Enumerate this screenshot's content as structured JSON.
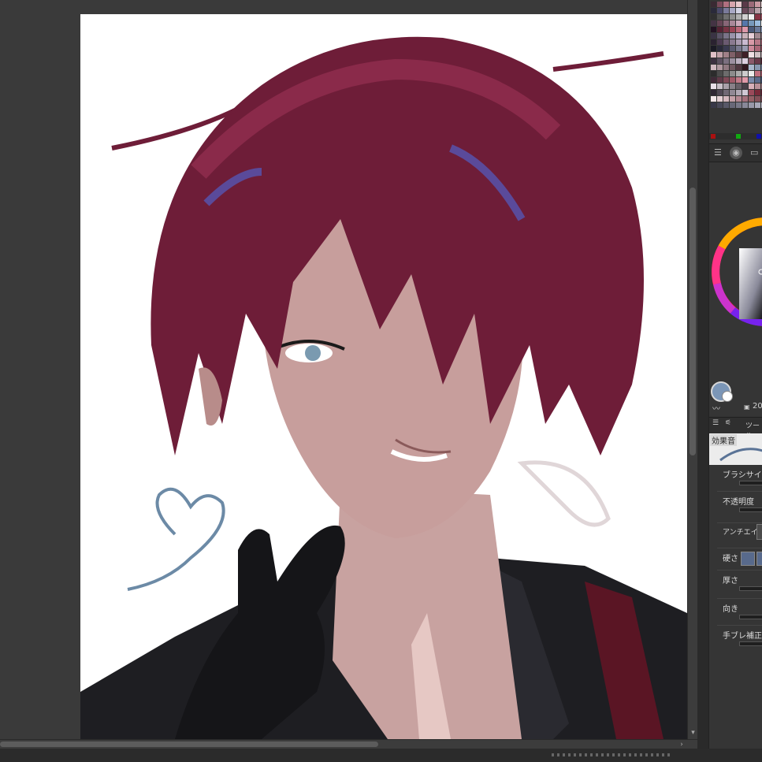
{
  "canvas": {
    "background": "#ffffff"
  },
  "panel": {
    "palette_colors": [
      "#3a2a33",
      "#7a4a5a",
      "#b07080",
      "#d7a5ad",
      "#e8c8cc",
      "#5a3a48",
      "#9b6a78",
      "#c999a2",
      "#f2dede",
      "#2a2a3a",
      "#4a4a6a",
      "#7a7a9a",
      "#a8a8c4",
      "#d2d2e2",
      "#6a4a5a",
      "#8a6a7a",
      "#b8a0a8",
      "#e0d0d4",
      "#303030",
      "#505050",
      "#707070",
      "#909090",
      "#b0b0b0",
      "#d0d0d0",
      "#f0f0f0",
      "#883344",
      "#aa5566",
      "#443344",
      "#664455",
      "#886677",
      "#aa8899",
      "#ccaabb",
      "#5577aa",
      "#7799bb",
      "#99bbdd",
      "#ffffff",
      "#221122",
      "#552233",
      "#773344",
      "#994455",
      "#bb6677",
      "#dd99aa",
      "#4a5a7a",
      "#6a7a9a",
      "#8a9aba",
      "#3a3344",
      "#5a5366",
      "#7a7388",
      "#9a93aa",
      "#bab3cc",
      "#c8b0b8",
      "#e8d0d8",
      "#a08890",
      "#806870",
      "#2a2230",
      "#4a3a50",
      "#6a5a70",
      "#8a7a90",
      "#aa9ab0",
      "#cabad0",
      "#d89aa8",
      "#b87888",
      "#985868",
      "#1a1a24",
      "#2a2a3a",
      "#3a3a50",
      "#5a5a70",
      "#7a7a90",
      "#9a9ab0",
      "#cc8899",
      "#aa6677",
      "#884455",
      "#e0c0c8",
      "#c0a0a8",
      "#a08088",
      "#806068",
      "#604048",
      "#402028",
      "#f0e0e4",
      "#d0c0c4",
      "#b0a0a4",
      "#3c3040",
      "#5c5060",
      "#7c7080",
      "#9c90a0",
      "#bcb0c0",
      "#dcd0e0",
      "#8a5a6a",
      "#6a3a4a",
      "#4a1a2a",
      "#d0b8c0",
      "#b098a0",
      "#907880",
      "#705860",
      "#503840",
      "#30181f",
      "#a9b8cc",
      "#8898b0",
      "#687894",
      "#2c2c2c",
      "#4c4c4c",
      "#6c6c6c",
      "#8c8c8c",
      "#acacac",
      "#cccccc",
      "#ececec",
      "#c07080",
      "#a05060",
      "#402a38",
      "#603a48",
      "#804a58",
      "#a05a68",
      "#c07a88",
      "#e09aa8",
      "#7a8aaa",
      "#5a6a8a",
      "#3a4a6a",
      "#e8e0e8",
      "#c8c0c8",
      "#a8a0a8",
      "#888088",
      "#686068",
      "#484048",
      "#d8b0b8",
      "#b89098",
      "#987078",
      "#302834",
      "#504854",
      "#706874",
      "#908894",
      "#b0a8b4",
      "#d0c8d4",
      "#9a4a5a",
      "#7a2a3a",
      "#5a1a2a",
      "#f4e8ea",
      "#e4d0d4",
      "#d4b8be",
      "#c4a0a8",
      "#b48892",
      "#a4707c",
      "#946066",
      "#845058",
      "#74404a",
      "#383848",
      "#484858",
      "#585868",
      "#686878",
      "#787888",
      "#888898",
      "#9898a8",
      "#a8a8b8",
      "#b8b8c8"
    ],
    "strip_colors": [
      "#aa1111",
      "#11aa11",
      "#1111aa"
    ],
    "brush_size_value": "20",
    "tool_tab_label": "ツール",
    "preset_label": "効果音",
    "properties": [
      {
        "label": "ブラシサイズ"
      },
      {
        "label": "不透明度"
      },
      {
        "label": "アンチエイリ"
      },
      {
        "label": "硬さ"
      },
      {
        "label": "厚さ"
      },
      {
        "label": "向き"
      },
      {
        "label": "手ブレ補正"
      }
    ],
    "main_color": "#7b96b7",
    "hardness_chip_color": "#586a8c"
  }
}
